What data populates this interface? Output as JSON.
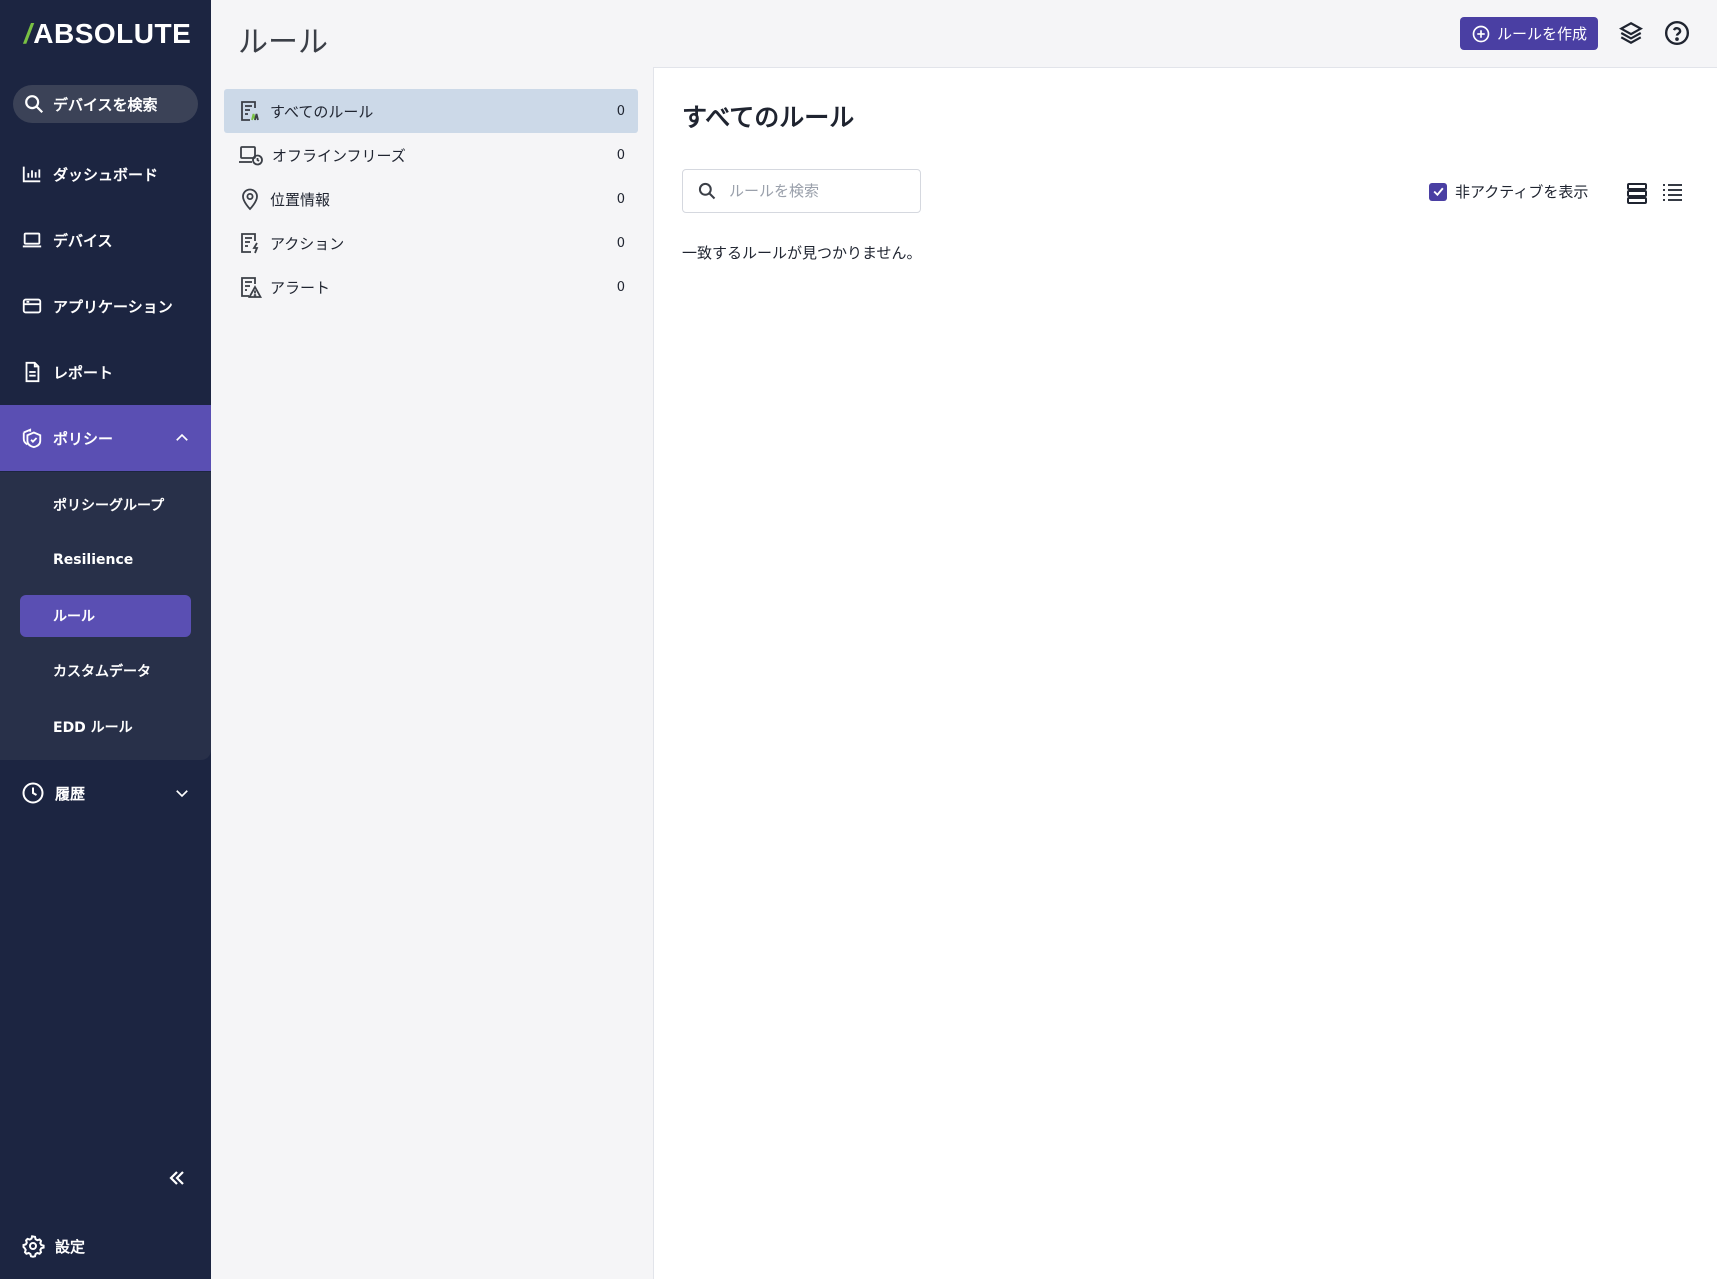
{
  "brand": {
    "logo_slash": "/",
    "logo_text": "ABSOLUTE",
    "accent": "#79c143"
  },
  "sidebar": {
    "search_label": "デバイスを検索",
    "items": [
      {
        "label": "ダッシュボード",
        "icon": "bar-chart-icon"
      },
      {
        "label": "デバイス",
        "icon": "laptop-icon"
      },
      {
        "label": "アプリケーション",
        "icon": "app-window-icon"
      },
      {
        "label": "レポート",
        "icon": "report-icon"
      },
      {
        "label": "ポリシー",
        "icon": "shield-icon",
        "expanded": true,
        "active": true
      },
      {
        "label": "履歴",
        "icon": "clock-icon",
        "expanded": false
      }
    ],
    "policy_submenu": [
      {
        "label": "ポリシーグループ"
      },
      {
        "label": "Resilience"
      },
      {
        "label": "ルール",
        "active": true
      },
      {
        "label": "カスタムデータ"
      },
      {
        "label": "EDD ルール"
      }
    ],
    "settings_label": "設定",
    "colors": {
      "background": "#1c2541",
      "active": "#5a4fb3"
    }
  },
  "header": {
    "title": "ルール",
    "create_button": "ルールを作成"
  },
  "categories": [
    {
      "label": "すべてのルール",
      "count": "0",
      "icon": "all-rules-icon",
      "active": true
    },
    {
      "label": "オフラインフリーズ",
      "count": "0",
      "icon": "offline-freeze-icon"
    },
    {
      "label": "位置情報",
      "count": "0",
      "icon": "location-pin-icon"
    },
    {
      "label": "アクション",
      "count": "0",
      "icon": "action-icon"
    },
    {
      "label": "アラート",
      "count": "0",
      "icon": "alert-icon"
    }
  ],
  "main": {
    "title": "すべてのルール",
    "search_placeholder": "ルールを検索",
    "show_inactive_label": "非アクティブを表示",
    "show_inactive_checked": true,
    "empty_message": "一致するルールが見つかりません。"
  }
}
